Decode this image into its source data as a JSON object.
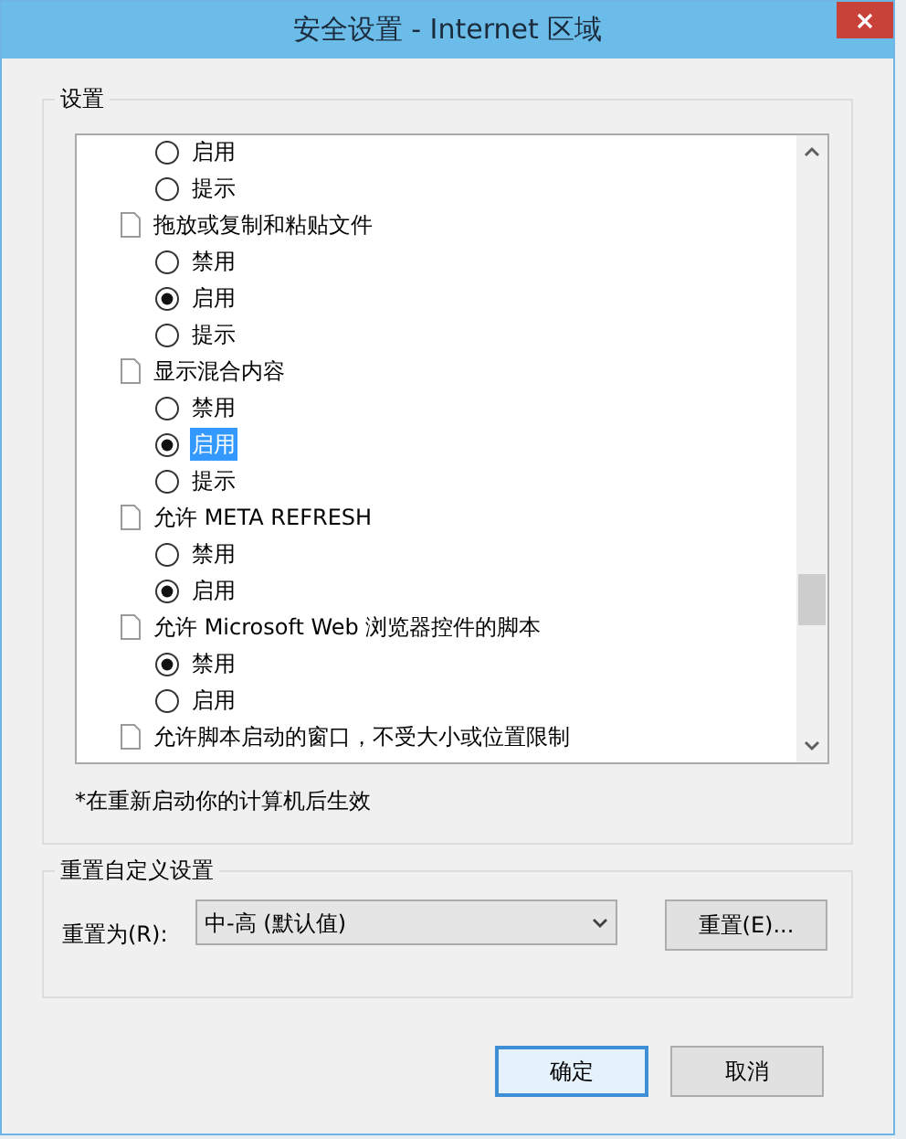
{
  "window": {
    "title": "安全设置 - Internet 区域"
  },
  "settings": {
    "title": "设置",
    "groups": [
      {
        "options": [
          {
            "label": "启用",
            "selected": false,
            "focused": false
          },
          {
            "label": "提示",
            "selected": false,
            "focused": false
          }
        ]
      },
      {
        "heading": "拖放或复制和粘贴文件",
        "options": [
          {
            "label": "禁用",
            "selected": false,
            "focused": false
          },
          {
            "label": "启用",
            "selected": true,
            "focused": false
          },
          {
            "label": "提示",
            "selected": false,
            "focused": false
          }
        ]
      },
      {
        "heading": "显示混合内容",
        "options": [
          {
            "label": "禁用",
            "selected": false,
            "focused": false
          },
          {
            "label": "启用",
            "selected": true,
            "focused": true
          },
          {
            "label": "提示",
            "selected": false,
            "focused": false
          }
        ]
      },
      {
        "heading": "允许 META REFRESH",
        "options": [
          {
            "label": "禁用",
            "selected": false,
            "focused": false
          },
          {
            "label": "启用",
            "selected": true,
            "focused": false
          }
        ]
      },
      {
        "heading": "允许 Microsoft Web 浏览器控件的脚本",
        "options": [
          {
            "label": "禁用",
            "selected": true,
            "focused": false
          },
          {
            "label": "启用",
            "selected": false,
            "focused": false
          }
        ]
      },
      {
        "heading": "允许脚本启动的窗口，不受大小或位置限制"
      }
    ],
    "note": "*在重新启动你的计算机后生效"
  },
  "reset": {
    "title": "重置自定义设置",
    "label": "重置为(R):",
    "value": "中-高 (默认值)",
    "button": "重置(E)..."
  },
  "buttons": [
    {
      "label": "确定",
      "default": true
    },
    {
      "label": "取消",
      "default": false
    }
  ]
}
